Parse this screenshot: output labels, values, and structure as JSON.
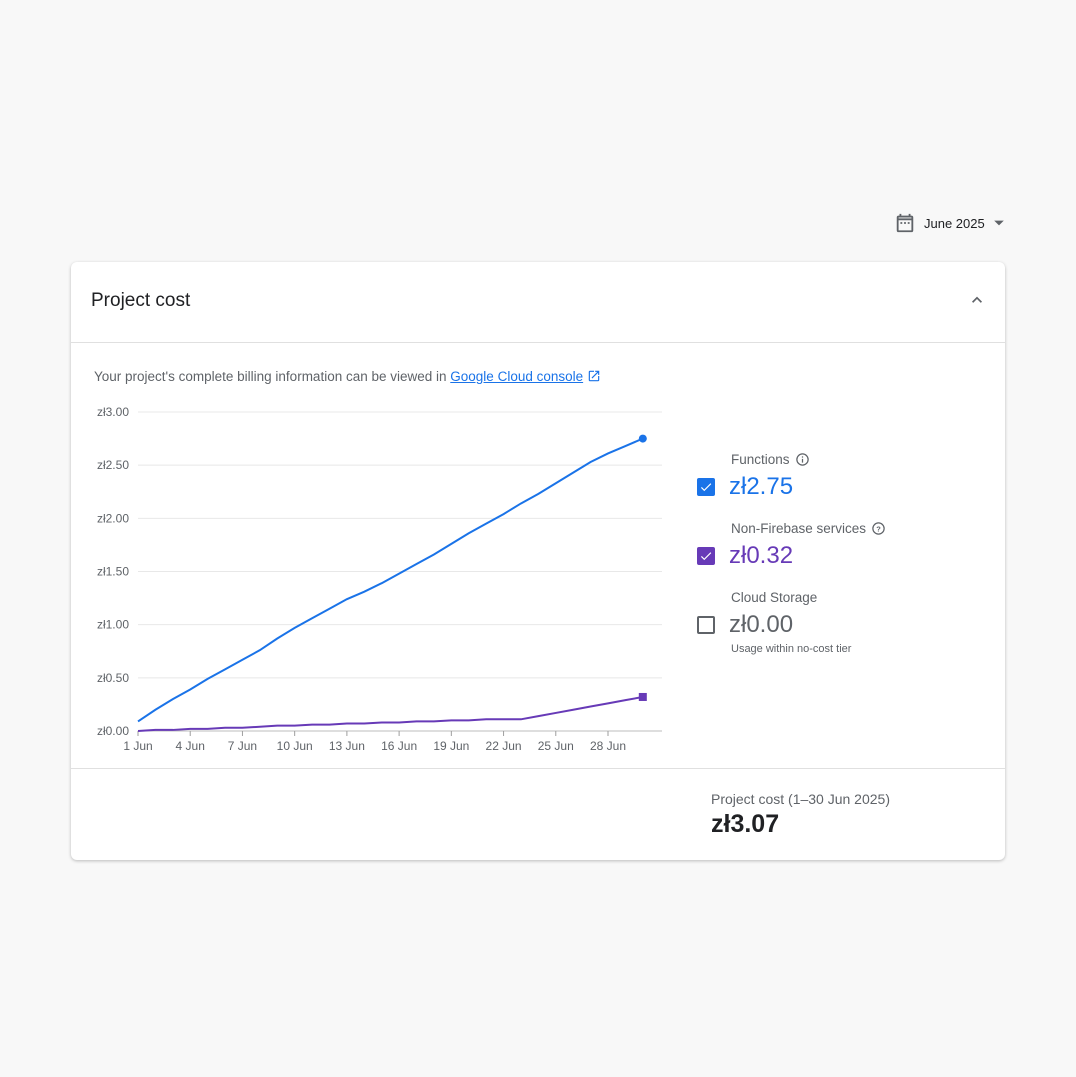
{
  "period_selector": {
    "label": "June 2025",
    "icon": "calendar-icon"
  },
  "card": {
    "title": "Project cost",
    "info_text": "Your project's complete billing information can be viewed in ",
    "info_link": "Google Cloud console",
    "legend": [
      {
        "label": "Functions",
        "value": "zł2.75",
        "checked": true,
        "color": "#1a73e8",
        "help_icon": "info-icon"
      },
      {
        "label": "Non-Firebase services",
        "value": "zł0.32",
        "checked": true,
        "color": "#673ab7",
        "help_icon": "help-icon"
      },
      {
        "label": "Cloud Storage",
        "value": "zł0.00",
        "checked": false,
        "color": "#5f6368",
        "note": "Usage within no-cost tier"
      }
    ],
    "total_label": "Project cost (1–30 Jun 2025)",
    "total_value": "zł3.07"
  },
  "chart_data": {
    "type": "line",
    "x": [
      1,
      2,
      3,
      4,
      5,
      6,
      7,
      8,
      9,
      10,
      11,
      12,
      13,
      14,
      15,
      16,
      17,
      18,
      19,
      20,
      21,
      22,
      23,
      24,
      25,
      26,
      27,
      28,
      29,
      30
    ],
    "xticks": [
      1,
      4,
      7,
      10,
      13,
      16,
      19,
      22,
      25,
      28
    ],
    "xtick_labels": [
      "1 Jun",
      "4 Jun",
      "7 Jun",
      "10 Jun",
      "13 Jun",
      "16 Jun",
      "19 Jun",
      "22 Jun",
      "25 Jun",
      "28 Jun"
    ],
    "yticks": [
      0,
      0.5,
      1,
      1.5,
      2,
      2.5,
      3
    ],
    "ytick_labels": [
      "zł0.00",
      "zł0.50",
      "zł1.00",
      "zł1.50",
      "zł2.00",
      "zł2.50",
      "zł3.00"
    ],
    "ylim": [
      0,
      3
    ],
    "xlim": [
      1,
      30
    ],
    "grid": true,
    "series": [
      {
        "name": "Functions",
        "color": "#1a73e8",
        "marker": "circle",
        "values": [
          0.09,
          0.2,
          0.3,
          0.39,
          0.49,
          0.58,
          0.67,
          0.76,
          0.87,
          0.97,
          1.06,
          1.15,
          1.24,
          1.31,
          1.39,
          1.48,
          1.57,
          1.66,
          1.76,
          1.86,
          1.95,
          2.04,
          2.14,
          2.23,
          2.33,
          2.43,
          2.53,
          2.61,
          2.68,
          2.75
        ]
      },
      {
        "name": "Non-Firebase services",
        "color": "#673ab7",
        "marker": "square",
        "values": [
          0.0,
          0.01,
          0.01,
          0.02,
          0.02,
          0.03,
          0.03,
          0.04,
          0.05,
          0.05,
          0.06,
          0.06,
          0.07,
          0.07,
          0.08,
          0.08,
          0.09,
          0.09,
          0.1,
          0.1,
          0.11,
          0.11,
          0.11,
          0.14,
          0.17,
          0.2,
          0.23,
          0.26,
          0.29,
          0.32
        ]
      }
    ]
  }
}
